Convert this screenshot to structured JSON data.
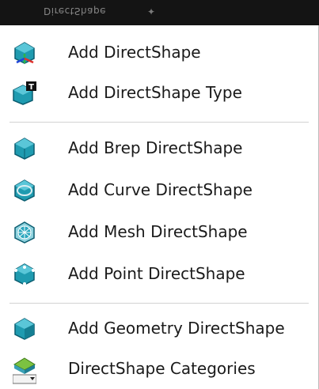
{
  "panel": {
    "title": "DirectShape"
  },
  "items": [
    {
      "label": "Add DirectShape",
      "icon": "shape-axes-icon"
    },
    {
      "label": "Add DirectShape Type",
      "icon": "shape-type-icon"
    },
    {
      "label": "Add Brep DirectShape",
      "icon": "brep-shape-icon"
    },
    {
      "label": "Add Curve DirectShape",
      "icon": "curve-shape-icon"
    },
    {
      "label": "Add Mesh DirectShape",
      "icon": "mesh-shape-icon"
    },
    {
      "label": "Add Point DirectShape",
      "icon": "point-shape-icon"
    },
    {
      "label": "Add Geometry DirectShape",
      "icon": "geometry-shape-icon"
    },
    {
      "label": "DirectShape Categories",
      "icon": "categories-dropdown-icon"
    }
  ],
  "colors": {
    "icon_teal": "#1f9bb0",
    "icon_teal_dark": "#0b5d70",
    "titlebar": "#141414"
  }
}
